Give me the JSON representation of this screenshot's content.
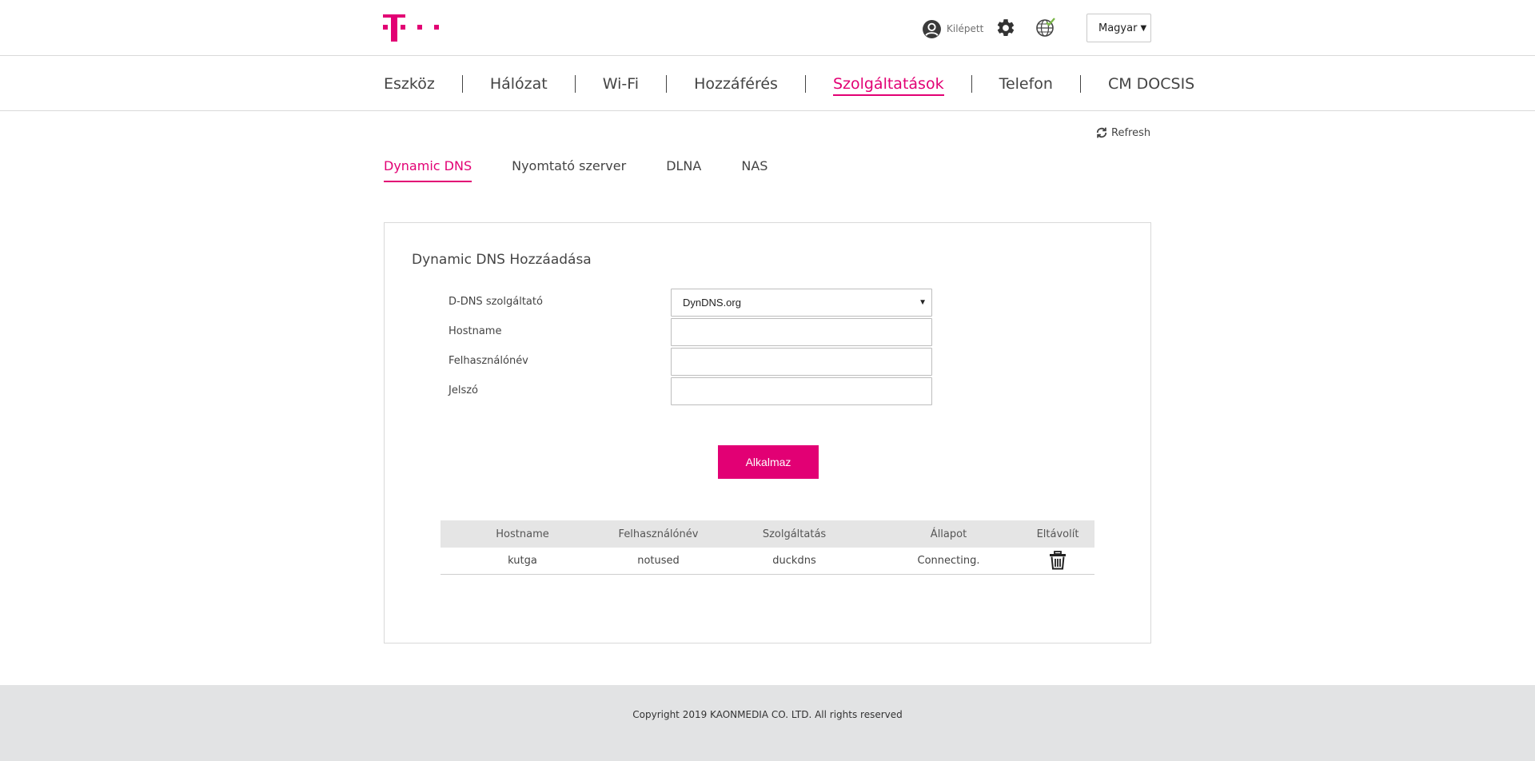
{
  "header": {
    "user_label": "Kilépett",
    "language": "Magyar",
    "brand_color": "#e20074"
  },
  "nav": {
    "items": [
      {
        "label": "Eszköz"
      },
      {
        "label": "Hálózat"
      },
      {
        "label": "Wi-Fi"
      },
      {
        "label": "Hozzáférés"
      },
      {
        "label": "Szolgáltatások",
        "active": true
      },
      {
        "label": "Telefon"
      },
      {
        "label": "CM DOCSIS"
      }
    ]
  },
  "refresh_label": "Refresh",
  "sub_tabs": [
    {
      "label": "Dynamic DNS",
      "active": true
    },
    {
      "label": "Nyomtató szerver"
    },
    {
      "label": "DLNA"
    },
    {
      "label": "NAS"
    }
  ],
  "panel": {
    "title": "Dynamic DNS Hozzáadása",
    "form": {
      "provider_label": "D-DNS szolgáltató",
      "provider_value": "DynDNS.org",
      "hostname_label": "Hostname",
      "hostname_value": "",
      "username_label": "Felhasználónév",
      "username_value": "",
      "password_label": "Jelszó",
      "password_value": ""
    },
    "apply_label": "Alkalmaz"
  },
  "table": {
    "headers": [
      "Hostname",
      "Felhasználónév",
      "Szolgáltatás",
      "Állapot",
      "Eltávolít"
    ],
    "rows": [
      {
        "hostname": "kutga",
        "username": "notused",
        "service": "duckdns",
        "status": "Connecting."
      }
    ]
  },
  "footer": {
    "copyright": "Copyright 2019 KAONMEDIA CO. LTD. All rights reserved"
  },
  "icons": {
    "logo": "telekom-logo",
    "user": "user-icon",
    "settings": "gear-icon",
    "language": "globe-icon",
    "refresh": "refresh-icon",
    "delete": "trash-icon"
  }
}
